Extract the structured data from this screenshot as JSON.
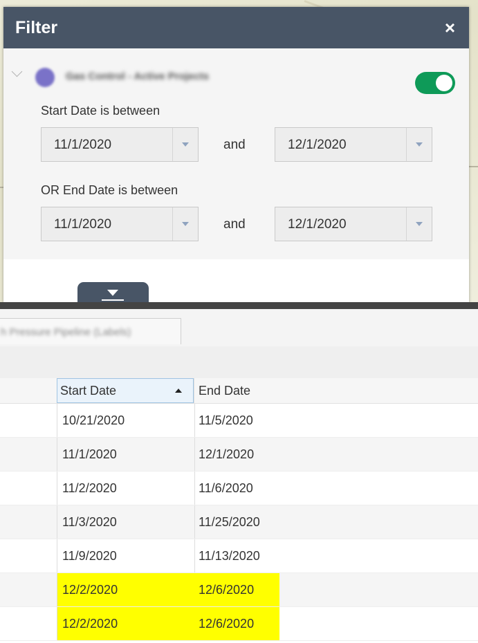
{
  "filter_panel": {
    "title": "Filter",
    "close_glyph": "×",
    "layer_name": "Gas Control - Active Projects",
    "layer_color": "#7a72c8",
    "toggle_on": true,
    "toggle_color": "#0e9a58",
    "start_label": "Start Date is between",
    "start_from": "11/1/2020",
    "start_to": "12/1/2020",
    "and1": "and",
    "end_label": "OR End Date is between",
    "end_from": "11/1/2020",
    "end_to": "12/1/2020",
    "and2": "and"
  },
  "table": {
    "tab_label": "h Pressure Pipeline (Labels)",
    "columns": [
      "Start Date",
      "End Date"
    ],
    "sort": "ascending",
    "highlight_color": "#ffff00",
    "rows": [
      {
        "start": "10/21/2020",
        "end": "11/5/2020"
      },
      {
        "start": "11/1/2020",
        "end": "12/1/2020"
      },
      {
        "start": "11/2/2020",
        "end": "11/6/2020"
      },
      {
        "start": "11/3/2020",
        "end": "11/25/2020"
      },
      {
        "start": "11/9/2020",
        "end": "11/13/2020"
      },
      {
        "start": "12/2/2020",
        "end": "12/6/2020",
        "highlighted": true
      },
      {
        "start": "12/2/2020",
        "end": "12/6/2020",
        "highlighted": true
      }
    ]
  }
}
